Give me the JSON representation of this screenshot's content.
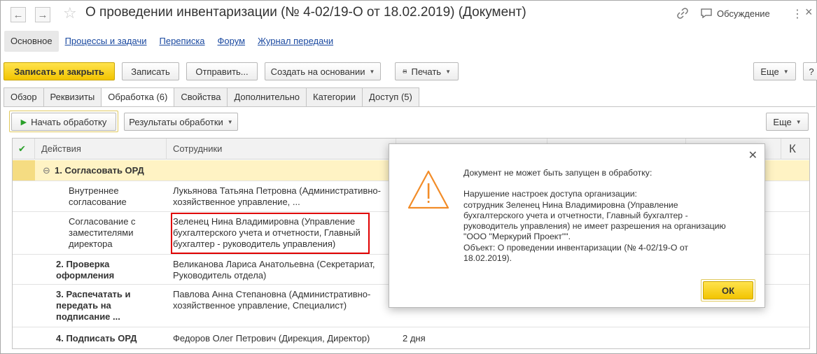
{
  "window": {
    "title": "О проведении инвентаризации (№ 4-02/19-О от 18.02.2019) (Документ)",
    "discussion_label": "Обсуждение"
  },
  "nav_panel": {
    "items": [
      {
        "label": "Основное",
        "active": true
      },
      {
        "label": "Процессы и задачи"
      },
      {
        "label": "Переписка"
      },
      {
        "label": "Форум"
      },
      {
        "label": "Журнал передачи"
      }
    ]
  },
  "command_bar": {
    "save_close": "Записать и закрыть",
    "save": "Записать",
    "send": "Отправить...",
    "create_based": "Создать на основании",
    "print": "Печать",
    "more": "Еще"
  },
  "form_tabs": [
    {
      "label": "Обзор"
    },
    {
      "label": "Реквизиты"
    },
    {
      "label": "Обработка (6)",
      "active": true
    },
    {
      "label": "Свойства"
    },
    {
      "label": "Дополнительно"
    },
    {
      "label": "Категории"
    },
    {
      "label": "Доступ (5)"
    }
  ],
  "processing_bar": {
    "start": "Начать обработку",
    "results": "Результаты обработки",
    "more": "Еще"
  },
  "table": {
    "columns": {
      "actions": "Действия",
      "employees": "Сотрудники",
      "last": "К"
    },
    "rows": [
      {
        "action": "1. Согласовать ОРД",
        "employees": "",
        "term": ""
      },
      {
        "action": "Внутреннее согласование",
        "employees": "Лукьянова Татьяна Петровна (Административно-хозяйственное управление, ...",
        "term": ""
      },
      {
        "action": "Согласование с заместителями директора",
        "employees": "Зеленец Нина Владимировна (Управление бухгалтерского учета и отчетности, Главный бухгалтер - руководитель управления)",
        "term": ""
      },
      {
        "action": "2. Проверка оформления",
        "employees": "Великанова Лариса Анатольевна (Секретариат, Руководитель отдела)",
        "term": ""
      },
      {
        "action": "3. Распечатать и передать на подписание ...",
        "employees": "Павлова Анна Степановна (Административно-хозяйственное управление, Специалист)",
        "term": ""
      },
      {
        "action": "4. Подписать ОРД",
        "employees": "Федоров Олег Петрович (Дирекция, Директор)",
        "term": "2 дня"
      }
    ]
  },
  "dialog": {
    "line1": "Документ не может быть запущен в обработку:",
    "line2": "Нарушение настроек доступа организации:",
    "line3": "сотрудник Зеленец Нина Владимировна (Управление",
    "line4": "бухгалтерского учета и отчетности, Главный бухгалтер -",
    "line5": "руководитель управления) не имеет разрешения на организацию",
    "line6": "\"ООО \"Меркурий Проект\"\".",
    "line7": "Объект: О проведении инвентаризации (№ 4-02/19-О от",
    "line8": "18.02.2019).",
    "ok": "ОК"
  },
  "colors": {
    "accent_yellow": "#f2c400",
    "link_blue": "#1a49a0",
    "highlight_red": "#e00000",
    "group_row_bg": "#fff3c4",
    "warning_orange": "#f28c28"
  }
}
